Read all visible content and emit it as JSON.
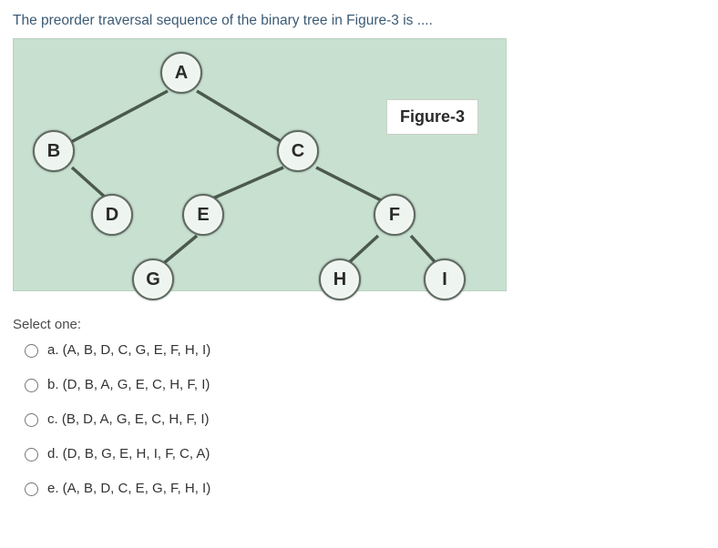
{
  "question": "The preorder traversal sequence of the binary tree in Figure-3 is ....",
  "figure": {
    "label": "Figure-3",
    "nodes": {
      "A": "A",
      "B": "B",
      "C": "C",
      "D": "D",
      "E": "E",
      "F": "F",
      "G": "G",
      "H": "H",
      "I": "I"
    }
  },
  "prompt": "Select one:",
  "options": [
    {
      "key": "a",
      "text": "a. (A, B, D, C, G, E, F, H, I)"
    },
    {
      "key": "b",
      "text": "b. (D, B, A, G, E, C, H, F, I)"
    },
    {
      "key": "c",
      "text": "c. (B, D, A, G, E, C, H, F, I)"
    },
    {
      "key": "d",
      "text": "d. (D, B, G, E, H, I, F, C, A)"
    },
    {
      "key": "e",
      "text": "e. (A, B, D, C, E, G, F, H, I)"
    }
  ]
}
